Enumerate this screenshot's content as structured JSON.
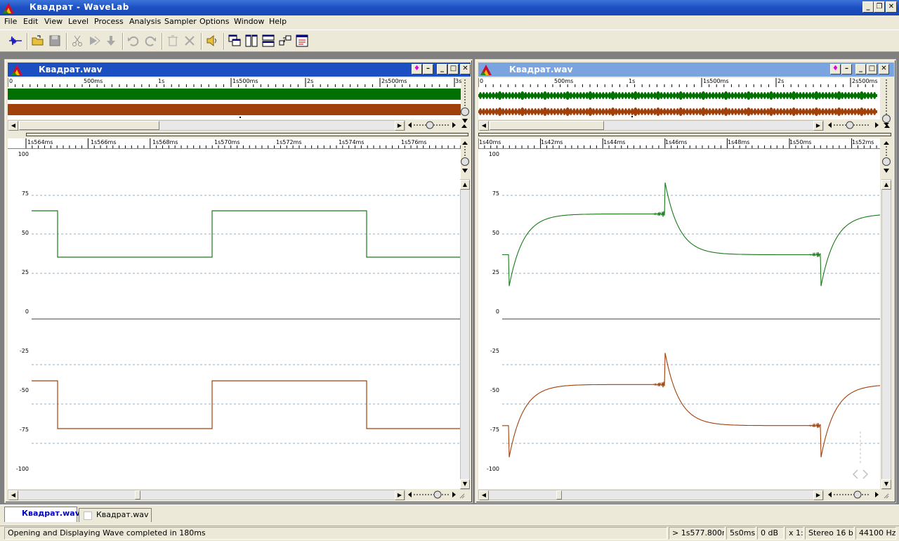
{
  "app": {
    "title": "Квадрат - WaveLab"
  },
  "menu": [
    "File",
    "Edit",
    "View",
    "Level",
    "Process",
    "Analysis",
    "Sampler",
    "Options",
    "Window",
    "Help"
  ],
  "colors": {
    "channel_left": "#1a7a1a",
    "channel_right": "#a0400a",
    "overview_left": "#007000",
    "overview_right": "#a0400a",
    "active_title": "#1c4fc2",
    "inactive_title": "#7aa4e0"
  },
  "windows": {
    "left": {
      "title": "Квадрат.wav",
      "overview_ruler": [
        "0",
        "500ms",
        "1s",
        "1s500ms",
        "2s",
        "2s500ms",
        "3s"
      ],
      "detail_ruler": [
        "1s564ms",
        "1s566ms",
        "1s568ms",
        "1s570ms",
        "1s572ms",
        "1s574ms",
        "1s576ms"
      ],
      "scale": [
        "100",
        "75",
        "50",
        "25",
        "0",
        "-25",
        "-50",
        "-75",
        "-100"
      ]
    },
    "right": {
      "title": "Квадрат.wav",
      "overview_ruler": [
        "0",
        "500ms",
        "1s",
        "1s500ms",
        "2s",
        "2s500ms"
      ],
      "detail_ruler": [
        "1s40ms",
        "1s42ms",
        "1s44ms",
        "1s46ms",
        "1s48ms",
        "1s50ms",
        "1s52ms"
      ],
      "scale": [
        "100",
        "75",
        "50",
        "25",
        "0",
        "-25",
        "-50",
        "-75",
        "-100"
      ]
    }
  },
  "tabs": [
    {
      "label": "Квадрат.wav",
      "active": true
    },
    {
      "label": "Квадрат.wav",
      "active": false
    }
  ],
  "status": {
    "message": "Opening and Displaying Wave completed in 180ms",
    "position": "> 1s577.800ms",
    "length": "5s0ms",
    "level": "0 dB",
    "zoom": "x 1:1",
    "format": "Stereo 16 bit",
    "rate": "44100 Hz"
  }
}
